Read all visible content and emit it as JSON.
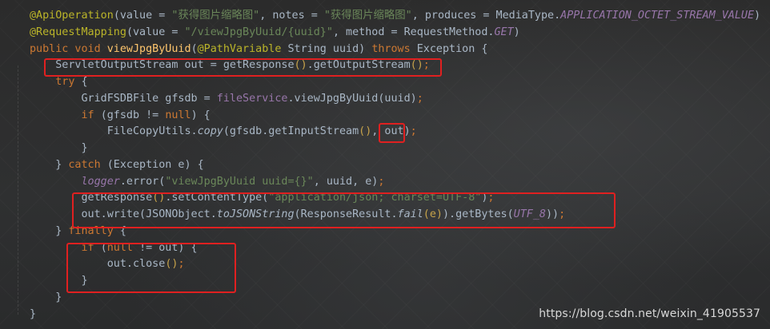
{
  "code": {
    "lines": [
      [
        {
          "t": "@ApiOperation",
          "c": "ann"
        },
        {
          "t": "(value = ",
          "c": "plain"
        },
        {
          "t": "\"获得图片缩略图\"",
          "c": "str"
        },
        {
          "t": ", notes = ",
          "c": "plain"
        },
        {
          "t": "\"获得图片缩略图\"",
          "c": "str"
        },
        {
          "t": ", produces = MediaType.",
          "c": "plain"
        },
        {
          "t": "APPLICATION_OCTET_STREAM_VALUE",
          "c": "cnst"
        },
        {
          "t": ")",
          "c": "plain"
        }
      ],
      [
        {
          "t": "@RequestMapping",
          "c": "ann"
        },
        {
          "t": "(value = ",
          "c": "plain"
        },
        {
          "t": "\"/viewJpgByUuid/{uuid}\"",
          "c": "str"
        },
        {
          "t": ", method = RequestMethod.",
          "c": "plain"
        },
        {
          "t": "GET",
          "c": "cnst"
        },
        {
          "t": ")",
          "c": "plain"
        }
      ],
      [
        {
          "t": "public void ",
          "c": "kw"
        },
        {
          "t": "viewJpgByUuid",
          "c": "fn"
        },
        {
          "t": "(",
          "c": "plain"
        },
        {
          "t": "@PathVariable ",
          "c": "ann"
        },
        {
          "t": "String uuid) ",
          "c": "plain"
        },
        {
          "t": "throws ",
          "c": "kw"
        },
        {
          "t": "Exception {",
          "c": "plain"
        }
      ],
      [
        {
          "t": "    ServletOutputStream out = getResponse",
          "c": "plain"
        },
        {
          "t": "()",
          "c": "brk"
        },
        {
          "t": ".getOutputStream",
          "c": "plain"
        },
        {
          "t": "()",
          "c": "brk"
        },
        {
          "t": ";",
          "c": "kw"
        }
      ],
      [
        {
          "t": "    ",
          "c": "plain"
        },
        {
          "t": "try ",
          "c": "kw"
        },
        {
          "t": "{",
          "c": "plain"
        }
      ],
      [
        {
          "t": "        GridFSDBFile gfsdb = ",
          "c": "plain"
        },
        {
          "t": "fileService",
          "c": "fld"
        },
        {
          "t": ".viewJpgByUuid(uuid)",
          "c": "plain"
        },
        {
          "t": ";",
          "c": "kw"
        }
      ],
      [
        {
          "t": "        ",
          "c": "plain"
        },
        {
          "t": "if ",
          "c": "kw"
        },
        {
          "t": "(gfsdb != ",
          "c": "plain"
        },
        {
          "t": "null",
          "c": "kw"
        },
        {
          "t": ") {",
          "c": "plain"
        }
      ],
      [
        {
          "t": "            FileCopyUtils.",
          "c": "plain"
        },
        {
          "t": "copy",
          "c": "ital"
        },
        {
          "t": "(gfsdb.getInputStream",
          "c": "plain"
        },
        {
          "t": "()",
          "c": "brk"
        },
        {
          "t": ", out",
          "c": "plain"
        },
        {
          "t": ")",
          "c": "plain"
        },
        {
          "t": ";",
          "c": "kw"
        }
      ],
      [
        {
          "t": "        }",
          "c": "plain"
        }
      ],
      [
        {
          "t": "    } ",
          "c": "plain"
        },
        {
          "t": "catch ",
          "c": "kw"
        },
        {
          "t": "(Exception e) {",
          "c": "plain"
        }
      ],
      [
        {
          "t": "        ",
          "c": "plain"
        },
        {
          "t": "logger",
          "c": "cnst"
        },
        {
          "t": ".error(",
          "c": "plain"
        },
        {
          "t": "\"viewJpgByUuid uuid={}\"",
          "c": "str"
        },
        {
          "t": ", uuid, e)",
          "c": "plain"
        },
        {
          "t": ";",
          "c": "kw"
        }
      ],
      [
        {
          "t": "        getResponse",
          "c": "plain"
        },
        {
          "t": "()",
          "c": "brk"
        },
        {
          "t": ".setContentType(",
          "c": "plain"
        },
        {
          "t": "\"application/json; charset=UTF-8\"",
          "c": "str"
        },
        {
          "t": ")",
          "c": "plain"
        },
        {
          "t": ";",
          "c": "kw"
        }
      ],
      [
        {
          "t": "        out.write(JSONObject.",
          "c": "plain"
        },
        {
          "t": "toJSONString",
          "c": "ital"
        },
        {
          "t": "(ResponseResult.",
          "c": "plain"
        },
        {
          "t": "fail",
          "c": "ital"
        },
        {
          "t": "(e)",
          "c": "brk"
        },
        {
          "t": ").getBytes(",
          "c": "plain"
        },
        {
          "t": "UTF_8",
          "c": "cnst"
        },
        {
          "t": "))",
          "c": "plain"
        },
        {
          "t": ";",
          "c": "kw"
        }
      ],
      [
        {
          "t": "    } ",
          "c": "plain"
        },
        {
          "t": "finally ",
          "c": "kw"
        },
        {
          "t": "{",
          "c": "plain"
        }
      ],
      [
        {
          "t": "        ",
          "c": "plain"
        },
        {
          "t": "if ",
          "c": "kw"
        },
        {
          "t": "(",
          "c": "plain"
        },
        {
          "t": "null ",
          "c": "kw"
        },
        {
          "t": "!= out) {",
          "c": "plain"
        }
      ],
      [
        {
          "t": "            out.close",
          "c": "plain"
        },
        {
          "t": "()",
          "c": "brk"
        },
        {
          "t": ";",
          "c": "kw"
        }
      ],
      [
        {
          "t": "        }",
          "c": "plain"
        }
      ],
      [
        {
          "t": "    }",
          "c": "plain"
        }
      ],
      [
        {
          "t": "}",
          "c": "plain"
        }
      ]
    ]
  },
  "watermark": "https://blog.csdn.net/weixin_41905537",
  "colors": {
    "annotation": "#bbb529",
    "keyword": "#cc7832",
    "string": "#6a8759",
    "method_declaration": "#ffc66d",
    "field": "#9876aa",
    "highlight_box": "#e02020"
  }
}
